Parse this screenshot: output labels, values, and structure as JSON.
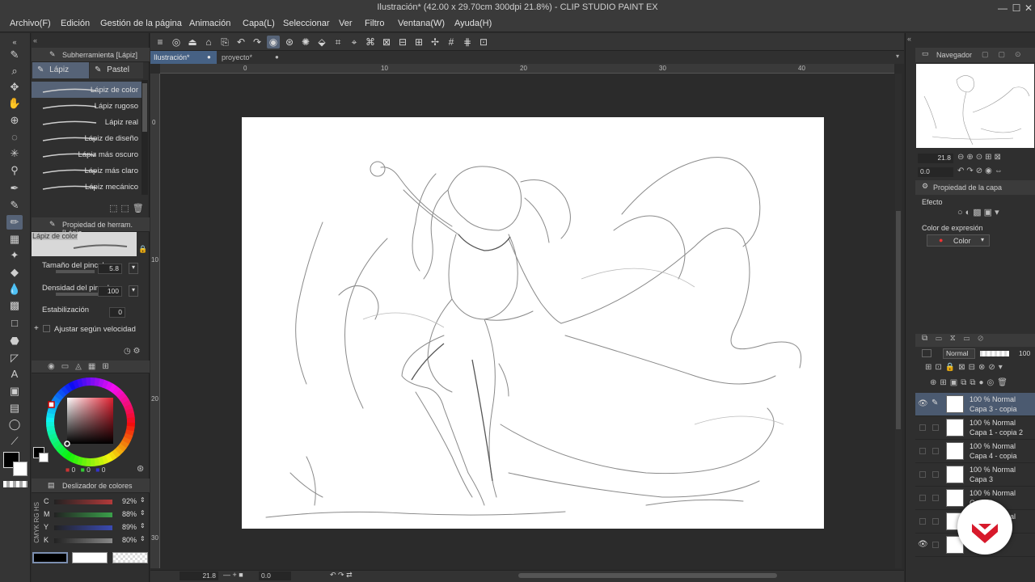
{
  "window": {
    "title": "Ilustración* (42.00 x 29.70cm 300dpi 21.8%)  - CLIP STUDIO PAINT EX",
    "minimize": "—",
    "maximize": "☐",
    "close": "✕"
  },
  "menu": [
    "Archivo(F)",
    "Edición",
    "Gestión de la página",
    "Animación",
    "Capa(L)",
    "Seleccionar",
    "Ver",
    "Filtro",
    "Ventana(W)",
    "Ayuda(H)"
  ],
  "subtool": {
    "header": "Subherramienta [Lápiz]",
    "tabs": [
      "Lápiz",
      "Pastel"
    ],
    "brushes": [
      "Lápiz de color",
      "Lápiz rugoso",
      "Lápiz real",
      "Lápiz de diseño",
      "Lápiz más oscuro",
      "Lápiz más claro",
      "Lápiz mecánico"
    ]
  },
  "tool_property": {
    "header": "Propiedad de herram. [Lápiz",
    "preset_name": "Lápiz de color",
    "brush_size_label": "Tamaño del pincel",
    "brush_size_value": "5.8",
    "density_label": "Densidad del pincel",
    "density_value": "100",
    "stabilization_label": "Estabilización",
    "stabilization_value": "0",
    "speed_label": "Ajustar según velocidad"
  },
  "color_wheel": {
    "r": "0",
    "g": "0",
    "b": "0",
    "main_color": "#000000",
    "sub_color": "#ffffff"
  },
  "color_slider": {
    "header": "Deslizador de colores",
    "side_labels": [
      "CMYK",
      "RG",
      "HS"
    ],
    "rows": [
      {
        "label": "C",
        "value": "92%",
        "color": "#b33a3a"
      },
      {
        "label": "M",
        "value": "88%",
        "color": "#3aa04a"
      },
      {
        "label": "Y",
        "value": "89%",
        "color": "#3a4ab3"
      },
      {
        "label": "K",
        "value": "80%",
        "color": "#888888"
      }
    ]
  },
  "canvas": {
    "tabs": [
      "Ilustración*",
      "proyecto*"
    ],
    "ruler_h": [
      "0",
      "10",
      "20",
      "30",
      "40"
    ],
    "ruler_v": [
      "0",
      "10",
      "20",
      "30"
    ],
    "zoom": "21.8",
    "rotation": "0.0"
  },
  "navigator": {
    "tab": "Navegador",
    "zoom": "21.8",
    "rotation": "0.0"
  },
  "layer_property": {
    "header": "Propiedad de la capa",
    "effect_label": "Efecto",
    "expression_label": "Color de expresión",
    "expression_value": "Color"
  },
  "layers": {
    "blend_mode": "Normal",
    "opacity": "100",
    "rows": [
      {
        "line1": "100 % Normal",
        "line2": "Capa 3 - copia",
        "visible": true,
        "selected": true
      },
      {
        "line1": "100 % Normal",
        "line2": "Capa 1 - copia 2",
        "visible": false,
        "selected": false
      },
      {
        "line1": "100 % Normal",
        "line2": "Capa 4 - copia",
        "visible": false,
        "selected": false
      },
      {
        "line1": "100 % Normal",
        "line2": "Capa 3",
        "visible": false,
        "selected": false
      },
      {
        "line1": "100 % Normal",
        "line2": "Capa 2",
        "visible": false,
        "selected": false
      },
      {
        "line1": "100 % Normal",
        "line2": "",
        "visible": false,
        "selected": false
      },
      {
        "line1": "",
        "line2": "",
        "visible": true,
        "selected": false
      }
    ]
  },
  "colors": {
    "accent": "#566377",
    "logo_red": "#d7192b"
  }
}
